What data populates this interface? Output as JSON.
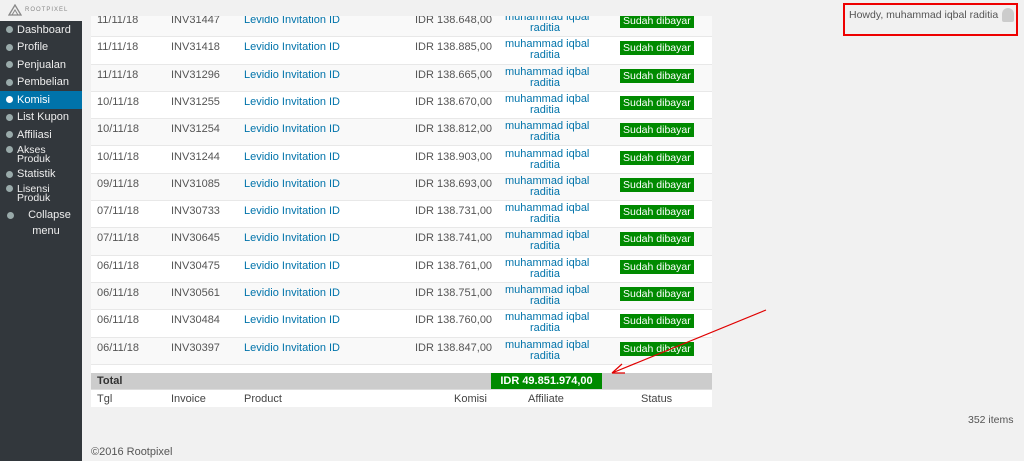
{
  "brand": {
    "logo_text": "ROOTPIXEL"
  },
  "adminbar": {
    "howdy": "Howdy, muhammad iqbal raditia"
  },
  "sidebar": {
    "items": [
      {
        "label": "Dashboard",
        "icon": "dashboard-icon"
      },
      {
        "label": "Profile",
        "icon": "user-icon"
      },
      {
        "label": "Penjualan",
        "icon": "gear-icon"
      },
      {
        "label": "Pembelian",
        "icon": "gear-icon"
      },
      {
        "label": "Komisi",
        "icon": "gear-icon",
        "active": true
      },
      {
        "label": "List Kupon",
        "icon": "list-icon"
      },
      {
        "label": "Affiliasi",
        "icon": "gear-icon"
      },
      {
        "label": "Akses Produk",
        "icon": "gear-icon"
      },
      {
        "label": "Statistik",
        "icon": "gear-icon"
      },
      {
        "label": "Lisensi Produk",
        "icon": "gear-icon"
      }
    ],
    "collapse_line1": "Collapse",
    "collapse_line2": "menu"
  },
  "table": {
    "rows": [
      {
        "date": "11/11/18",
        "invoice": "INV31447",
        "product": "Levidio Invitation ID",
        "komisi": "IDR 138.648,00",
        "aff1": "muhammad iqbal",
        "aff2": "raditia",
        "status": "Sudah dibayar"
      },
      {
        "date": "11/11/18",
        "invoice": "INV31418",
        "product": "Levidio Invitation ID",
        "komisi": "IDR 138.885,00",
        "aff1": "muhammad iqbal",
        "aff2": "raditia",
        "status": "Sudah dibayar"
      },
      {
        "date": "11/11/18",
        "invoice": "INV31296",
        "product": "Levidio Invitation ID",
        "komisi": "IDR 138.665,00",
        "aff1": "muhammad iqbal",
        "aff2": "raditia",
        "status": "Sudah dibayar"
      },
      {
        "date": "10/11/18",
        "invoice": "INV31255",
        "product": "Levidio Invitation ID",
        "komisi": "IDR 138.670,00",
        "aff1": "muhammad iqbal",
        "aff2": "raditia",
        "status": "Sudah dibayar"
      },
      {
        "date": "10/11/18",
        "invoice": "INV31254",
        "product": "Levidio Invitation ID",
        "komisi": "IDR 138.812,00",
        "aff1": "muhammad iqbal",
        "aff2": "raditia",
        "status": "Sudah dibayar"
      },
      {
        "date": "10/11/18",
        "invoice": "INV31244",
        "product": "Levidio Invitation ID",
        "komisi": "IDR 138.903,00",
        "aff1": "muhammad iqbal",
        "aff2": "raditia",
        "status": "Sudah dibayar"
      },
      {
        "date": "09/11/18",
        "invoice": "INV31085",
        "product": "Levidio Invitation ID",
        "komisi": "IDR 138.693,00",
        "aff1": "muhammad iqbal",
        "aff2": "raditia",
        "status": "Sudah dibayar"
      },
      {
        "date": "07/11/18",
        "invoice": "INV30733",
        "product": "Levidio Invitation ID",
        "komisi": "IDR 138.731,00",
        "aff1": "muhammad iqbal",
        "aff2": "raditia",
        "status": "Sudah dibayar"
      },
      {
        "date": "07/11/18",
        "invoice": "INV30645",
        "product": "Levidio Invitation ID",
        "komisi": "IDR 138.741,00",
        "aff1": "muhammad iqbal",
        "aff2": "raditia",
        "status": "Sudah dibayar"
      },
      {
        "date": "06/11/18",
        "invoice": "INV30475",
        "product": "Levidio Invitation ID",
        "komisi": "IDR 138.761,00",
        "aff1": "muhammad iqbal",
        "aff2": "raditia",
        "status": "Sudah dibayar"
      },
      {
        "date": "06/11/18",
        "invoice": "INV30561",
        "product": "Levidio Invitation ID",
        "komisi": "IDR 138.751,00",
        "aff1": "muhammad iqbal",
        "aff2": "raditia",
        "status": "Sudah dibayar"
      },
      {
        "date": "06/11/18",
        "invoice": "INV30484",
        "product": "Levidio Invitation ID",
        "komisi": "IDR 138.760,00",
        "aff1": "muhammad iqbal",
        "aff2": "raditia",
        "status": "Sudah dibayar"
      },
      {
        "date": "06/11/18",
        "invoice": "INV30397",
        "product": "Levidio Invitation ID",
        "komisi": "IDR 138.847,00",
        "aff1": "muhammad iqbal",
        "aff2": "raditia",
        "status": "Sudah dibayar"
      }
    ],
    "total_label": "Total",
    "total_amount": "IDR 49.851.974,00",
    "columns": [
      "Tgl",
      "Invoice",
      "Product",
      "Komisi",
      "Affiliate",
      "Status"
    ]
  },
  "pagination": {
    "items_count": "352 items"
  },
  "footer": {
    "copyright": "©2016 Rootpixel"
  },
  "colors": {
    "sidebar_bg": "#32373c",
    "active": "#0073aa",
    "paid": "#008a00",
    "annotation": "#e00000"
  }
}
